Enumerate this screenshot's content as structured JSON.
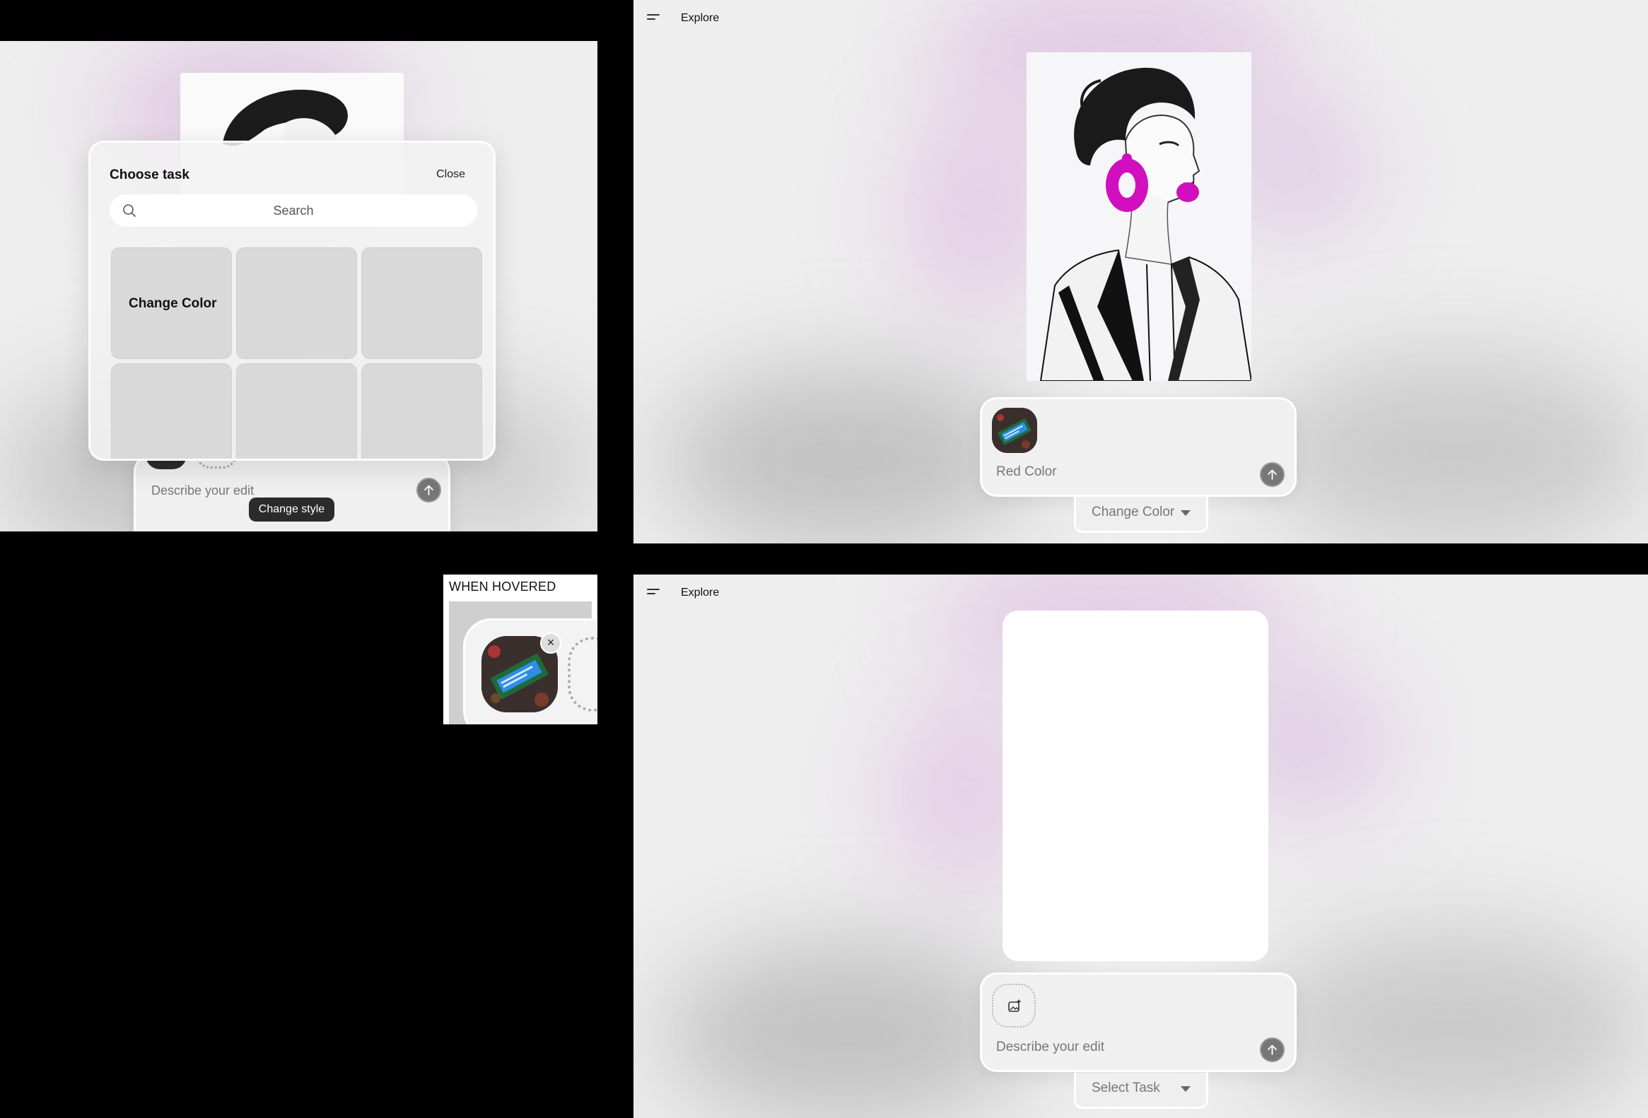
{
  "task_chooser": {
    "title": "Choose task",
    "close_label": "Close",
    "search_placeholder": "Search",
    "tiles": [
      "Change Color",
      "",
      "",
      "",
      "",
      ""
    ],
    "composer_placeholder": "Describe your edit",
    "tooltip": "Change style"
  },
  "editor_result": {
    "nav_title": "Explore",
    "prompt_text": "Red Color",
    "task_label": "Change Color"
  },
  "hover_note": {
    "label": "WHEN HOVERED",
    "remove_symbol": "×"
  },
  "editor_empty": {
    "nav_title": "Explore",
    "prompt_placeholder": "Describe your edit",
    "task_label": "Select Task"
  },
  "icons": {
    "menu": "menu-icon",
    "search": "search-icon",
    "send": "arrow-up-icon",
    "add_image": "add-image-icon",
    "dropdown": "caret-down-icon",
    "remove": "close-icon"
  },
  "colors": {
    "accent_magenta": "#d10fbf",
    "background": "#eeeeee",
    "tooltip_bg": "#2b2b2b",
    "send_button": "#777777"
  }
}
